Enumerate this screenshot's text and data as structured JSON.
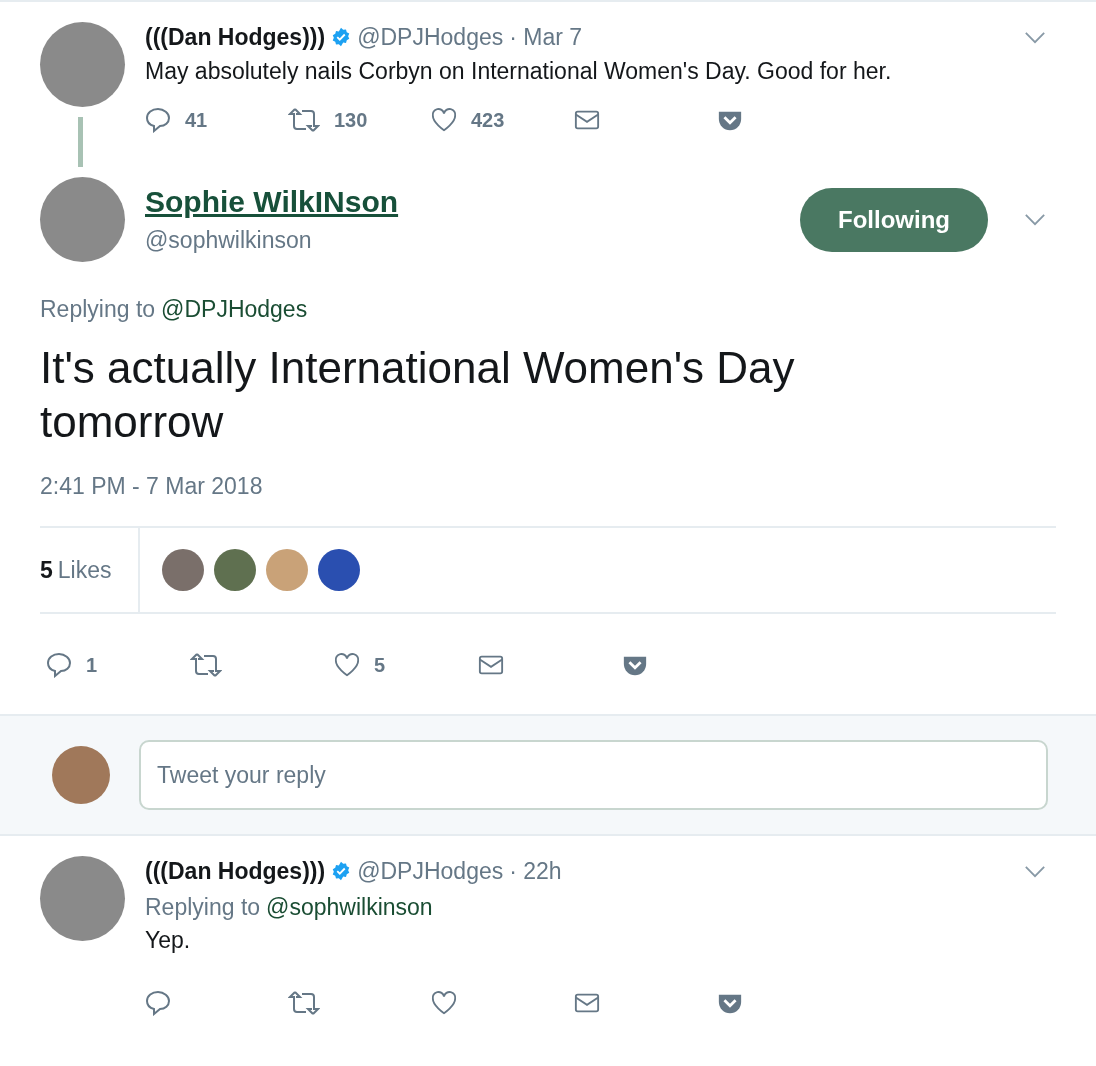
{
  "parent_tweet": {
    "name": "(((Dan Hodges)))",
    "verified": true,
    "handle": "@DPJHodges",
    "time": "· Mar 7",
    "text": "May absolutely nails Corbyn on International Women's Day. Good for her.",
    "actions": [
      {
        "kind": "reply",
        "count": "41"
      },
      {
        "kind": "retweet",
        "count": "130"
      },
      {
        "kind": "like",
        "count": "423"
      },
      {
        "kind": "message"
      },
      {
        "kind": "pocket"
      }
    ]
  },
  "focus_tweet": {
    "name": "Sophie WilkINson",
    "handle": "@sophwilkinson",
    "follow_button": "Following",
    "replying_label": "Replying to",
    "replying_to": "@DPJHodges",
    "text": "It's actually International Women's Day tomorrow",
    "timestamp": "2:41 PM - 7 Mar 2018",
    "likes_count": "5",
    "likes_label": "Likes",
    "actions": [
      {
        "kind": "reply",
        "count": "1"
      },
      {
        "kind": "retweet"
      },
      {
        "kind": "like",
        "count": "5"
      },
      {
        "kind": "message"
      },
      {
        "kind": "pocket"
      }
    ]
  },
  "reply_box": {
    "placeholder": "Tweet your reply"
  },
  "replies": [
    {
      "name": "(((Dan Hodges)))",
      "verified": true,
      "handle": "@DPJHodges",
      "time": "· 22h",
      "replying_label": "Replying to",
      "replying_to": "@sophwilkinson",
      "text": "Yep.",
      "actions": [
        {
          "kind": "reply"
        },
        {
          "kind": "retweet"
        },
        {
          "kind": "like"
        },
        {
          "kind": "message"
        },
        {
          "kind": "pocket"
        }
      ]
    }
  ]
}
